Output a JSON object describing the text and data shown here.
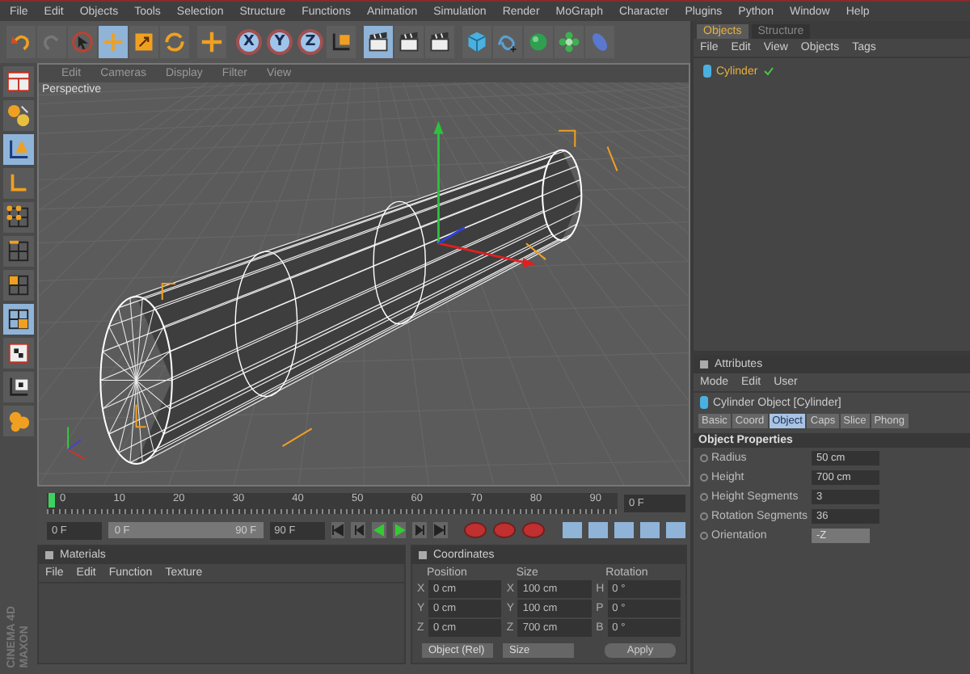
{
  "menu": [
    "File",
    "Edit",
    "Objects",
    "Tools",
    "Selection",
    "Structure",
    "Functions",
    "Animation",
    "Simulation",
    "Render",
    "MoGraph",
    "Character",
    "Plugins",
    "Python",
    "Window",
    "Help"
  ],
  "toolbar": [
    {
      "kind": "undo",
      "selected": false
    },
    {
      "kind": "redo",
      "selected": false
    },
    {
      "kind": "select",
      "selected": false
    },
    {
      "kind": "move",
      "selected": true
    },
    {
      "kind": "scale",
      "selected": false
    },
    {
      "kind": "rotate",
      "selected": false
    },
    {
      "kind": "sep"
    },
    {
      "kind": "add",
      "selected": false
    },
    {
      "kind": "sep"
    },
    {
      "kind": "axis",
      "label": "X",
      "selected": true
    },
    {
      "kind": "axis",
      "label": "Y",
      "selected": true
    },
    {
      "kind": "axis",
      "label": "Z",
      "selected": true
    },
    {
      "kind": "coord",
      "selected": false
    },
    {
      "kind": "sep"
    },
    {
      "kind": "clapper",
      "selected": true
    },
    {
      "kind": "clapper",
      "selected": false
    },
    {
      "kind": "clapper",
      "selected": false
    },
    {
      "kind": "sep"
    },
    {
      "kind": "cube",
      "selected": false
    },
    {
      "kind": "spline",
      "selected": false
    },
    {
      "kind": "sphere",
      "selected": false
    },
    {
      "kind": "flower",
      "selected": false
    },
    {
      "kind": "oval",
      "selected": false
    }
  ],
  "left_tools": [
    {
      "kind": "layout",
      "selected": false
    },
    {
      "kind": "editable",
      "selected": false
    },
    {
      "kind": "model",
      "selected": true
    },
    {
      "kind": "axes",
      "selected": false
    },
    {
      "kind": "points",
      "selected": false
    },
    {
      "kind": "edges",
      "selected": false
    },
    {
      "kind": "polygons",
      "selected": false
    },
    {
      "kind": "uv",
      "selected": true
    },
    {
      "kind": "checker",
      "selected": false
    },
    {
      "kind": "workplane",
      "selected": false
    },
    {
      "kind": "blob",
      "selected": false
    }
  ],
  "viewport": {
    "menu": [
      "Edit",
      "Cameras",
      "Display",
      "Filter",
      "View"
    ],
    "camera": "Perspective"
  },
  "timeline": {
    "ticks": [
      "0",
      "10",
      "20",
      "30",
      "40",
      "50",
      "60",
      "70",
      "80",
      "90"
    ],
    "current": "0 F",
    "start": "0 F",
    "range": {
      "start": "0 F",
      "end": "90 F",
      "level": 1
    },
    "end": "90 F"
  },
  "materials": {
    "title": "Materials",
    "menu": [
      "File",
      "Edit",
      "Function",
      "Texture"
    ]
  },
  "coordinates": {
    "title": "Coordinates",
    "headers": [
      "Position",
      "Size",
      "Rotation"
    ],
    "rows": [
      {
        "axis": "X",
        "position": "0 cm",
        "size_axis": "X",
        "size": "100 cm",
        "rot_axis": "H",
        "rotation": "0 °"
      },
      {
        "axis": "Y",
        "position": "0 cm",
        "size_axis": "Y",
        "size": "100 cm",
        "rot_axis": "P",
        "rotation": "0 °"
      },
      {
        "axis": "Z",
        "position": "0 cm",
        "size_axis": "Z",
        "size": "700 cm",
        "rot_axis": "B",
        "rotation": "0 °"
      }
    ],
    "mode": "Object (Rel)",
    "size_mode": "Size",
    "apply": "Apply"
  },
  "logo": [
    "MAXON",
    "CINEMA 4D"
  ],
  "objects": {
    "tabs": [
      {
        "label": "Objects",
        "selected": true
      },
      {
        "label": "Structure",
        "selected": false
      }
    ],
    "menu": [
      "File",
      "Edit",
      "View",
      "Objects",
      "Tags"
    ],
    "items": [
      {
        "name": "Cylinder"
      }
    ]
  },
  "attributes": {
    "title": "Attributes",
    "menu": [
      "Mode",
      "Edit",
      "User"
    ],
    "object": "Cylinder Object [Cylinder]",
    "tabs": [
      {
        "label": "Basic",
        "selected": false
      },
      {
        "label": "Coord",
        "selected": false
      },
      {
        "label": "Object",
        "selected": true
      },
      {
        "label": "Caps",
        "selected": false
      },
      {
        "label": "Slice",
        "selected": false
      },
      {
        "label": "Phong",
        "selected": false
      }
    ],
    "section": "Object Properties",
    "fields": [
      {
        "kind": "number",
        "label": "Radius",
        "value": "50 cm"
      },
      {
        "kind": "number",
        "label": "Height",
        "value": "700 cm"
      },
      {
        "kind": "number",
        "label": "Height Segments",
        "value": "3"
      },
      {
        "kind": "number",
        "label": "Rotation Segments",
        "value": "36"
      },
      {
        "kind": "dropdown",
        "label": "Orientation",
        "value": "-Z"
      }
    ]
  }
}
